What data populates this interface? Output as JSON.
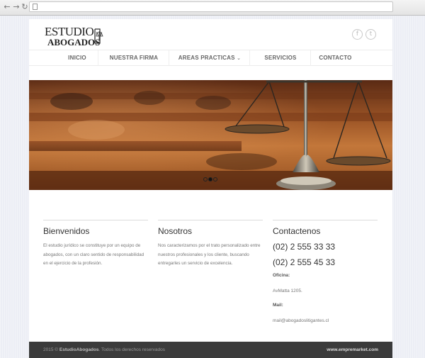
{
  "browser": {
    "back_icon": "back-arrow-icon",
    "forward_icon": "forward-arrow-icon",
    "reload_icon": "reload-icon",
    "url": ""
  },
  "logo": {
    "line1": "ESTUDIO",
    "line2": "ABOGADOS"
  },
  "social": {
    "facebook": "f",
    "twitter": "t"
  },
  "nav": {
    "items": [
      {
        "label": "INICIO"
      },
      {
        "label": "NUESTRA FIRMA"
      },
      {
        "label": "AREAS PRACTICAS"
      },
      {
        "label": "SERVICIOS"
      },
      {
        "label": "CONTACTO"
      }
    ]
  },
  "slider": {
    "current_slide": 2,
    "total_slides": 3
  },
  "bienvenidos": {
    "title": "Bienvenidos",
    "text": "El estudio jurídico se constituye por un equipo de abogados, con un claro sentido de responsabilidad en el ejercicio de la profesión."
  },
  "nosotros": {
    "title": "Nosotros",
    "text": "Nos caracterizamos por el trato personalizado entre nuestros profesionales y los cliente, buscando entregarles un servicio de excelencia."
  },
  "contacto": {
    "title": "Contactenos",
    "phone1": "(02) 2 555 33 33",
    "phone2": "(02) 2 555 45 33",
    "office_label": "Oficina:",
    "office_value": "AvMatta 1205.",
    "mail_label": "Mail:",
    "mail_value": "mail@abogadoslitigantes.cl"
  },
  "footer": {
    "year": "2015 ©",
    "brand": "EstudioAbogados",
    "rights": ". Todos los derechos reservados",
    "credit": "www.empremarket.com"
  },
  "colors": {
    "footer_bg": "#3b3b3b",
    "page_bg": "#eceef5",
    "hero_tone": "#a55e2a"
  }
}
